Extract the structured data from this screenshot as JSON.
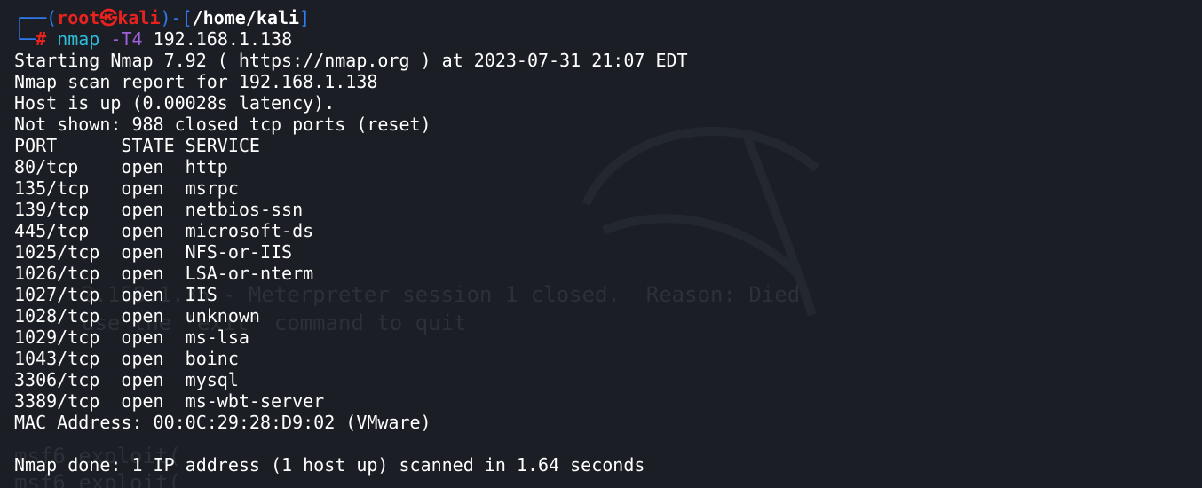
{
  "prompt": {
    "corner_top": "┌──(",
    "user": "root",
    "at": "㉿",
    "host": "kali",
    "mid": ")-[",
    "cwd": "/home/kali",
    "close": "]",
    "corner_bottom": "└─",
    "symbol": "#",
    "command": "nmap",
    "flag": "-T4",
    "target": "192.168.1.138"
  },
  "output": {
    "start": "Starting Nmap 7.92 ( https://nmap.org ) at 2023-07-31 21:07 EDT",
    "report": "Nmap scan report for 192.168.1.138",
    "host_up": "Host is up (0.00028s latency).",
    "not_shown": "Not shown: 988 closed tcp ports (reset)",
    "table_header": "PORT      STATE SERVICE",
    "ports": [
      "80/tcp    open  http",
      "135/tcp   open  msrpc",
      "139/tcp   open  netbios-ssn",
      "445/tcp   open  microsoft-ds",
      "1025/tcp  open  NFS-or-IIS",
      "1026/tcp  open  LSA-or-nterm",
      "1027/tcp  open  IIS",
      "1028/tcp  open  unknown",
      "1029/tcp  open  ms-lsa",
      "1043/tcp  open  boinc",
      "3306/tcp  open  mysql",
      "3389/tcp  open  ms-wbt-server"
    ],
    "mac": "MAC Address: 00:0C:29:28:D9:02 (VMware)",
    "done": "Nmap done: 1 IP address (1 host up) scanned in 1.64 seconds"
  },
  "ghost_text": {
    "l1": "2.168.1.35 - Meterpreter session 1 closed.  Reason: Died",
    "l2": "use the 'exit' command to quit",
    "l3": "msf6 exploit(",
    "l4": "msf6 exploit("
  },
  "colors": {
    "background": "#1b1e24",
    "prompt_bracket": "#2f7bf0",
    "prompt_user": "#e8221f",
    "command": "#2fbbd6",
    "flag": "#9f5fd8",
    "text": "#ffffff"
  }
}
